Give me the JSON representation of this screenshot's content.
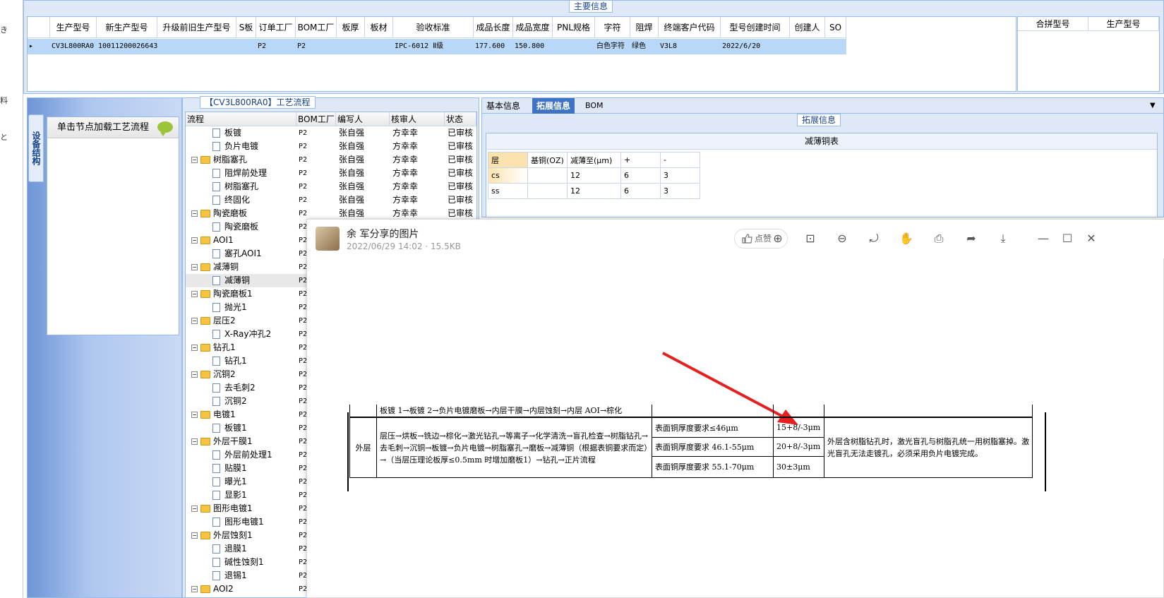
{
  "left_strip": {
    "chars": [
      "き",
      "料",
      "と"
    ]
  },
  "main_info": {
    "title": "主要信息",
    "columns": [
      "生产型号",
      "新生产型号",
      "升级前旧生产型号",
      "S板",
      "订单工厂",
      "BOM工厂",
      "板厚",
      "板材",
      "验收标准",
      "成品长度",
      "成品宽度",
      "PNL规格",
      "字符",
      "阻焊",
      "终端客户代码",
      "型号创建时间",
      "创建人",
      "SO"
    ],
    "row": [
      "CV3L800RA0",
      "10011200026643",
      "",
      "",
      "P2",
      "P2",
      "",
      "",
      "IPC-6012 Ⅱ级",
      "177.600",
      "150.800",
      "",
      "白色字符",
      "绿色",
      "V3L8",
      "2022/6/20",
      "",
      ""
    ],
    "merge_columns": [
      "合拼型号",
      "生产型号"
    ]
  },
  "device": {
    "tab_label": "设备结构",
    "load_hint": "单击节点加载工艺流程"
  },
  "flow": {
    "title": "【CV3L800RA0】工艺流程",
    "columns": [
      "流程",
      "BOM工厂",
      "编写人",
      "核审人",
      "状态"
    ],
    "rows": [
      {
        "name": "板镀",
        "level": 2,
        "bom": "P2",
        "writer": "张自强",
        "reviewer": "方幸幸",
        "status": "已审核"
      },
      {
        "name": "负片电镀",
        "level": 2,
        "bom": "P2",
        "writer": "张自强",
        "reviewer": "方幸幸",
        "status": "已审核"
      },
      {
        "name": "树脂塞孔",
        "level": 1,
        "bom": "P2",
        "writer": "张自强",
        "reviewer": "方幸幸",
        "status": "已审核"
      },
      {
        "name": "阻焊前处理",
        "level": 2,
        "bom": "P2",
        "writer": "张自强",
        "reviewer": "方幸幸",
        "status": "已审核"
      },
      {
        "name": "树脂塞孔",
        "level": 2,
        "bom": "P2",
        "writer": "张自强",
        "reviewer": "方幸幸",
        "status": "已审核"
      },
      {
        "name": "终固化",
        "level": 2,
        "bom": "P2",
        "writer": "张自强",
        "reviewer": "方幸幸",
        "status": "已审核"
      },
      {
        "name": "陶瓷磨板",
        "level": 1,
        "bom": "P2",
        "writer": "张自强",
        "reviewer": "方幸幸",
        "status": "已审核"
      },
      {
        "name": "陶瓷磨板",
        "level": 2,
        "bom": "P2",
        "writer": "",
        "reviewer": "",
        "status": ""
      },
      {
        "name": "AOI1",
        "level": 1,
        "bom": "P2",
        "writer": "",
        "reviewer": "",
        "status": ""
      },
      {
        "name": "塞孔AOI1",
        "level": 2,
        "bom": "P2",
        "writer": "",
        "reviewer": "",
        "status": ""
      },
      {
        "name": "减薄铜",
        "level": 1,
        "bom": "P2",
        "writer": "",
        "reviewer": "",
        "status": ""
      },
      {
        "name": "减薄铜",
        "level": 2,
        "bom": "P2",
        "writer": "",
        "reviewer": "",
        "status": "",
        "selected": true
      },
      {
        "name": "陶瓷磨板1",
        "level": 1,
        "bom": "P2",
        "writer": "",
        "reviewer": "",
        "status": ""
      },
      {
        "name": "抛光1",
        "level": 2,
        "bom": "P2",
        "writer": "",
        "reviewer": "",
        "status": ""
      },
      {
        "name": "层压2",
        "level": 1,
        "bom": "P2",
        "writer": "",
        "reviewer": "",
        "status": ""
      },
      {
        "name": "X-Ray冲孔2",
        "level": 2,
        "bom": "P2",
        "writer": "",
        "reviewer": "",
        "status": ""
      },
      {
        "name": "钻孔1",
        "level": 1,
        "bom": "P2",
        "writer": "",
        "reviewer": "",
        "status": ""
      },
      {
        "name": "钻孔1",
        "level": 2,
        "bom": "P2",
        "writer": "",
        "reviewer": "",
        "status": ""
      },
      {
        "name": "沉铜2",
        "level": 1,
        "bom": "P2",
        "writer": "",
        "reviewer": "",
        "status": ""
      },
      {
        "name": "去毛刺2",
        "level": 2,
        "bom": "P2",
        "writer": "",
        "reviewer": "",
        "status": ""
      },
      {
        "name": "沉铜2",
        "level": 2,
        "bom": "P2",
        "writer": "",
        "reviewer": "",
        "status": ""
      },
      {
        "name": "电镀1",
        "level": 1,
        "bom": "P2",
        "writer": "",
        "reviewer": "",
        "status": ""
      },
      {
        "name": "板镀1",
        "level": 2,
        "bom": "P2",
        "writer": "",
        "reviewer": "",
        "status": ""
      },
      {
        "name": "外层干膜1",
        "level": 1,
        "bom": "P2",
        "writer": "",
        "reviewer": "",
        "status": ""
      },
      {
        "name": "外层前处理1",
        "level": 2,
        "bom": "P2",
        "writer": "",
        "reviewer": "",
        "status": ""
      },
      {
        "name": "贴膜1",
        "level": 2,
        "bom": "P2",
        "writer": "",
        "reviewer": "",
        "status": ""
      },
      {
        "name": "曝光1",
        "level": 2,
        "bom": "P2",
        "writer": "",
        "reviewer": "",
        "status": ""
      },
      {
        "name": "显影1",
        "level": 2,
        "bom": "P2",
        "writer": "",
        "reviewer": "",
        "status": ""
      },
      {
        "name": "图形电镀1",
        "level": 1,
        "bom": "P2",
        "writer": "",
        "reviewer": "",
        "status": ""
      },
      {
        "name": "图形电镀1",
        "level": 2,
        "bom": "P2",
        "writer": "",
        "reviewer": "",
        "status": ""
      },
      {
        "name": "外层蚀刻1",
        "level": 1,
        "bom": "P2",
        "writer": "",
        "reviewer": "",
        "status": ""
      },
      {
        "name": "退膜1",
        "level": 2,
        "bom": "P2",
        "writer": "",
        "reviewer": "",
        "status": ""
      },
      {
        "name": "碱性蚀刻1",
        "level": 2,
        "bom": "P2",
        "writer": "",
        "reviewer": "",
        "status": ""
      },
      {
        "name": "退锡1",
        "level": 2,
        "bom": "P2",
        "writer": "",
        "reviewer": "",
        "status": ""
      },
      {
        "name": "AOI2",
        "level": 1,
        "bom": "P2",
        "writer": "",
        "reviewer": "",
        "status": ""
      }
    ]
  },
  "right": {
    "tabs": [
      "基本信息",
      "拓展信息",
      "BOM"
    ],
    "active_tab": "拓展信息",
    "section_title": "拓展信息",
    "copper_table": {
      "title": "减薄铜表",
      "columns": [
        "层",
        "基铜(OZ)",
        "减薄至(μm)",
        "+",
        "-"
      ],
      "rows": [
        [
          "cs",
          "",
          "12",
          "6",
          "3"
        ],
        [
          "ss",
          "",
          "12",
          "6",
          "3"
        ]
      ]
    }
  },
  "viewer": {
    "title": "余 军分享的图片",
    "meta": "2022/06/29 14:02 · 15.5KB",
    "like_label": "点赞",
    "doc": {
      "top_line": "板镀 1→板镀 2→负片电镀磨板→内层干膜→内层蚀刻→内层 AOI→棕化",
      "layer_label": "外层",
      "flow_text": "层压→烘板→铣边→棕化→激光钻孔→等离子→化学清洗→盲孔检查→树脂钻孔→去毛刺→沉铜→板镀→负片电镀→树脂塞孔→磨板→减薄铜（根据表铜要求而定）→（当层压理论板厚≤0.5mm 时增加磨板1）→钻孔→正片流程",
      "req": [
        "表面铜厚度要求≤46μm",
        "表面铜厚度要求 46.1-55μm",
        "表面铜厚度要求 55.1-70μm"
      ],
      "vals": [
        "15+8/-3μm",
        "20+8/-3μm",
        "30±3μm"
      ],
      "note": "外层含树脂钻孔时，激光盲孔与树脂孔统一用树脂塞掉。激光盲孔无法走镀孔，必须采用负片电镀完成。"
    }
  }
}
